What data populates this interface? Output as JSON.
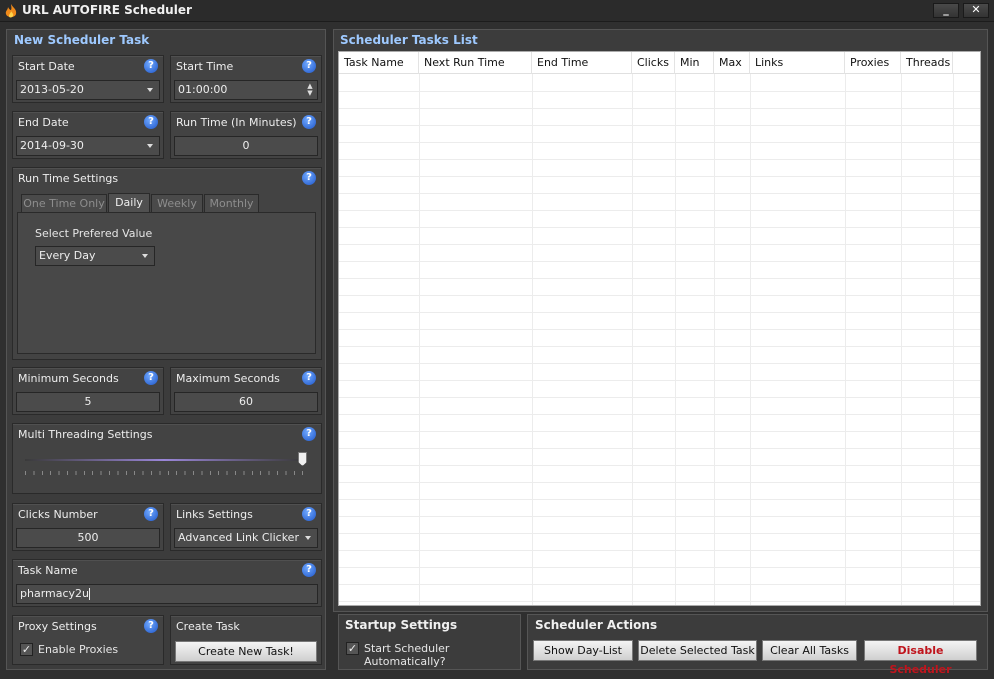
{
  "window": {
    "title": "URL AUTOFIRE Scheduler",
    "minimize": "_",
    "close": "✕"
  },
  "left": {
    "title": "New Scheduler Task",
    "start_date": {
      "label": "Start Date",
      "value": "2013-05-20"
    },
    "start_time": {
      "label": "Start Time",
      "value": "01:00:00"
    },
    "end_date": {
      "label": "End Date",
      "value": "2014-09-30"
    },
    "run_time": {
      "label": "Run Time (In Minutes)",
      "value": "0"
    },
    "run_settings": {
      "label": "Run Time Settings",
      "tabs": [
        "One Time Only",
        "Daily",
        "Weekly",
        "Monthly"
      ],
      "active_tab": "Daily",
      "select_label": "Select Prefered Value",
      "select_value": "Every Day"
    },
    "min_seconds": {
      "label": "Minimum Seconds",
      "value": "5"
    },
    "max_seconds": {
      "label": "Maximum Seconds",
      "value": "60"
    },
    "threading": {
      "label": "Multi Threading Settings",
      "level": 1.0
    },
    "clicks": {
      "label": "Clicks Number",
      "value": "500"
    },
    "links": {
      "label": "Links Settings",
      "value": "Advanced Link Clicker"
    },
    "task_name": {
      "label": "Task Name",
      "value": "pharmacy2u"
    },
    "proxy": {
      "label": "Proxy Settings",
      "checkbox": "Enable Proxies",
      "checked": true
    },
    "create": {
      "label": "Create Task",
      "button": "Create New Task!"
    }
  },
  "right": {
    "title": "Scheduler Tasks List",
    "columns": [
      "Task Name",
      "Next Run Time",
      "End Time",
      "Clicks",
      "Min",
      "Max",
      "Links",
      "Proxies",
      "Threads"
    ],
    "rows": []
  },
  "startup": {
    "title": "Startup Settings",
    "checkbox": "Start Scheduler Automatically?",
    "checked": true
  },
  "actions": {
    "title": "Scheduler Actions",
    "buttons": [
      "Show Day-List",
      "Delete Selected Task",
      "Clear All Tasks",
      "Disable Scheduler"
    ]
  },
  "colors": {
    "accent_title": "#9ec9ff",
    "danger": "#c0141c"
  },
  "icons": {
    "help": "help-icon",
    "app": "flame-icon",
    "dropdown": "chevron-down-icon"
  }
}
